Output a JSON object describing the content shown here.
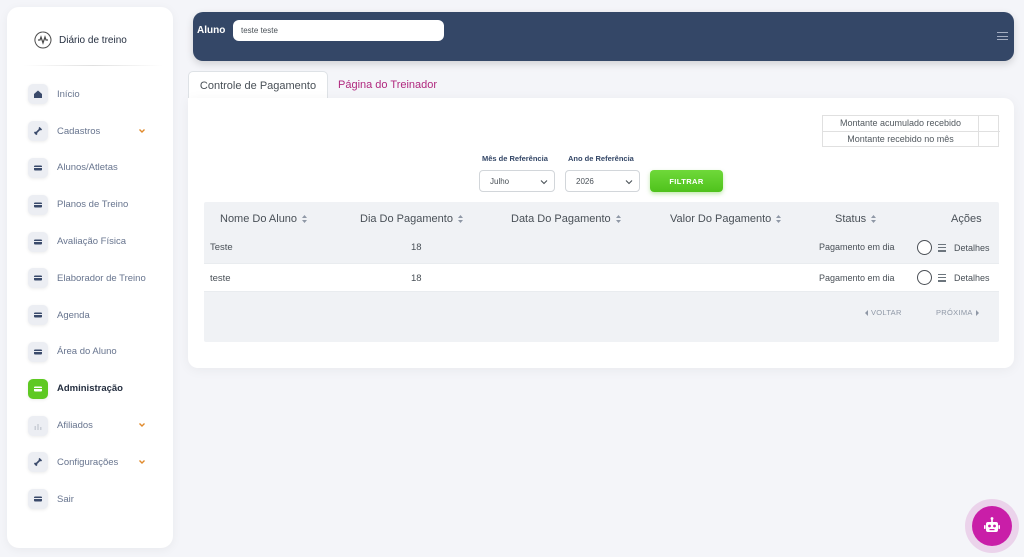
{
  "brand": {
    "name": "Diário de treino"
  },
  "sidebar": {
    "items": [
      {
        "label": "Início",
        "icon": "home-icon",
        "active": false,
        "expandable": false
      },
      {
        "label": "Cadastros",
        "icon": "tools-icon",
        "active": false,
        "expandable": true
      },
      {
        "label": "Alunos/Atletas",
        "icon": "card-icon",
        "active": false,
        "expandable": false
      },
      {
        "label": "Planos de Treino",
        "icon": "card-icon",
        "active": false,
        "expandable": false
      },
      {
        "label": "Avaliação Física",
        "icon": "card-icon",
        "active": false,
        "expandable": false
      },
      {
        "label": "Elaborador de Treino",
        "icon": "card-icon",
        "active": false,
        "expandable": false
      },
      {
        "label": "Agenda",
        "icon": "card-icon",
        "active": false,
        "expandable": false
      },
      {
        "label": "Área do Aluno",
        "icon": "card-icon",
        "active": false,
        "expandable": false
      },
      {
        "label": "Administração",
        "icon": "card-icon",
        "active": true,
        "expandable": false
      },
      {
        "label": "Afiliados",
        "icon": "chart-icon",
        "active": false,
        "expandable": true
      },
      {
        "label": "Configurações",
        "icon": "tools-icon",
        "active": false,
        "expandable": true
      },
      {
        "label": "Sair",
        "icon": "card-icon",
        "active": false,
        "expandable": false
      }
    ]
  },
  "topbar": {
    "label": "Aluno",
    "search_value": "teste teste"
  },
  "tabs": [
    {
      "label": "Controle de Pagamento",
      "active": true
    },
    {
      "label": "Página do Treinador",
      "active": false
    }
  ],
  "summary": {
    "accumulated_label": "Montante acumulado recebido",
    "accumulated_value": "",
    "month_label": "Montante recebido no mês",
    "month_value": ""
  },
  "filters": {
    "month_label": "Mês de Referência",
    "month_value": "Julho",
    "year_label": "Ano de Referência",
    "year_value": "2026",
    "button_label": "FILTRAR"
  },
  "table": {
    "columns": [
      "Nome Do Aluno",
      "Dia Do Pagamento",
      "Data Do Pagamento",
      "Valor Do Pagamento",
      "Status",
      "Ações"
    ],
    "rows": [
      {
        "name": "Teste",
        "day": "18",
        "date": "",
        "value": "",
        "status": "Pagamento em dia",
        "details": "Detalhes"
      },
      {
        "name": "teste",
        "day": "18",
        "date": "",
        "value": "",
        "status": "Pagamento em dia",
        "details": "Detalhes"
      }
    ],
    "prev_label": "VOLTAR",
    "next_label": "PRÓXIMA"
  },
  "colors": {
    "navbar": "#344767",
    "active_green": "#5ec922",
    "tab_link": "#b0287e",
    "bot": "#c91ea8"
  }
}
